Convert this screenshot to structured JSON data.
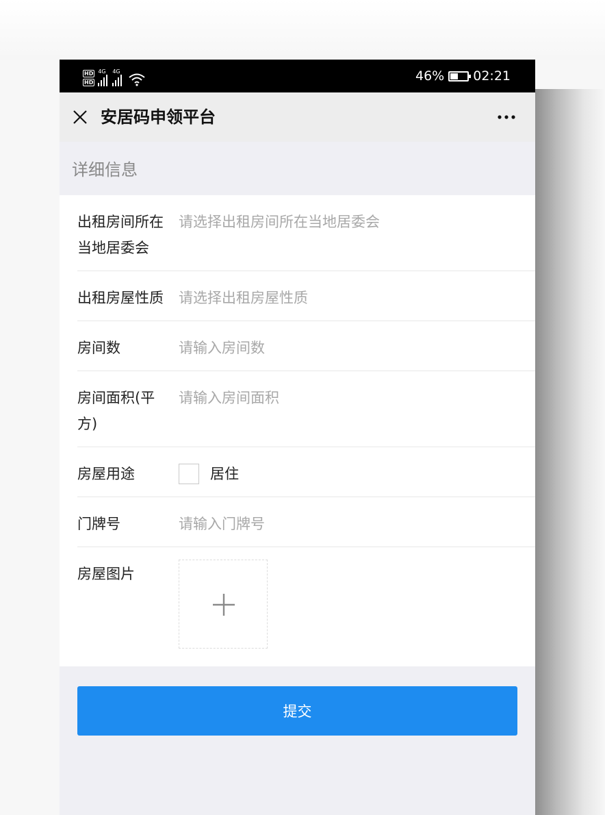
{
  "status_bar": {
    "hd_badges": [
      "HD",
      "HD"
    ],
    "network_1": "4G",
    "network_2": "4G",
    "battery_percent": "46%",
    "battery_level": 0.46,
    "time": "02:21"
  },
  "header": {
    "title": "安居码申领平台"
  },
  "section": {
    "title": "详细信息"
  },
  "form": {
    "fields": [
      {
        "label": "出租房间所在当地居委会",
        "placeholder": "请选择出租房间所在当地居委会"
      },
      {
        "label": "出租房屋性质",
        "placeholder": "请选择出租房屋性质"
      },
      {
        "label": "房间数",
        "placeholder": "请输入房间数"
      },
      {
        "label": "房间面积(平方)",
        "placeholder": "请输入房间面积"
      },
      {
        "label": "房屋用途",
        "option": "居住"
      },
      {
        "label": "门牌号",
        "placeholder": "请输入门牌号"
      },
      {
        "label": "房屋图片"
      }
    ]
  },
  "submit": {
    "label": "提交"
  },
  "colors": {
    "accent": "#1e8cf0",
    "placeholder": "#a8a8a8",
    "header_bg": "#ededed",
    "page_bg": "#efeff4"
  },
  "icons": [
    "close-icon",
    "more-icon",
    "plus-icon",
    "wifi-icon",
    "signal-icon",
    "battery-icon"
  ]
}
